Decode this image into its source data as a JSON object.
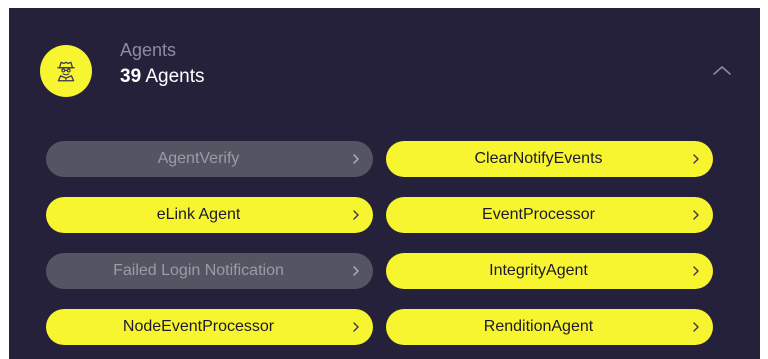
{
  "header": {
    "title": "Agents",
    "count_number": "39",
    "count_label": " Agents",
    "avatar_icon": "agent-spy-icon",
    "collapse_icon": "chevron-up-icon"
  },
  "colors": {
    "panel_bg": "#25213a",
    "accent_yellow": "#f7f430",
    "inactive_gray": "#545462"
  },
  "agents": [
    {
      "label": "AgentVerify",
      "status": "inactive"
    },
    {
      "label": "ClearNotifyEvents",
      "status": "active"
    },
    {
      "label": "eLink Agent",
      "status": "active"
    },
    {
      "label": "EventProcessor",
      "status": "active"
    },
    {
      "label": "Failed Login Notification",
      "status": "inactive"
    },
    {
      "label": "IntegrityAgent",
      "status": "active"
    },
    {
      "label": "NodeEventProcessor",
      "status": "active"
    },
    {
      "label": "RenditionAgent",
      "status": "active"
    }
  ]
}
